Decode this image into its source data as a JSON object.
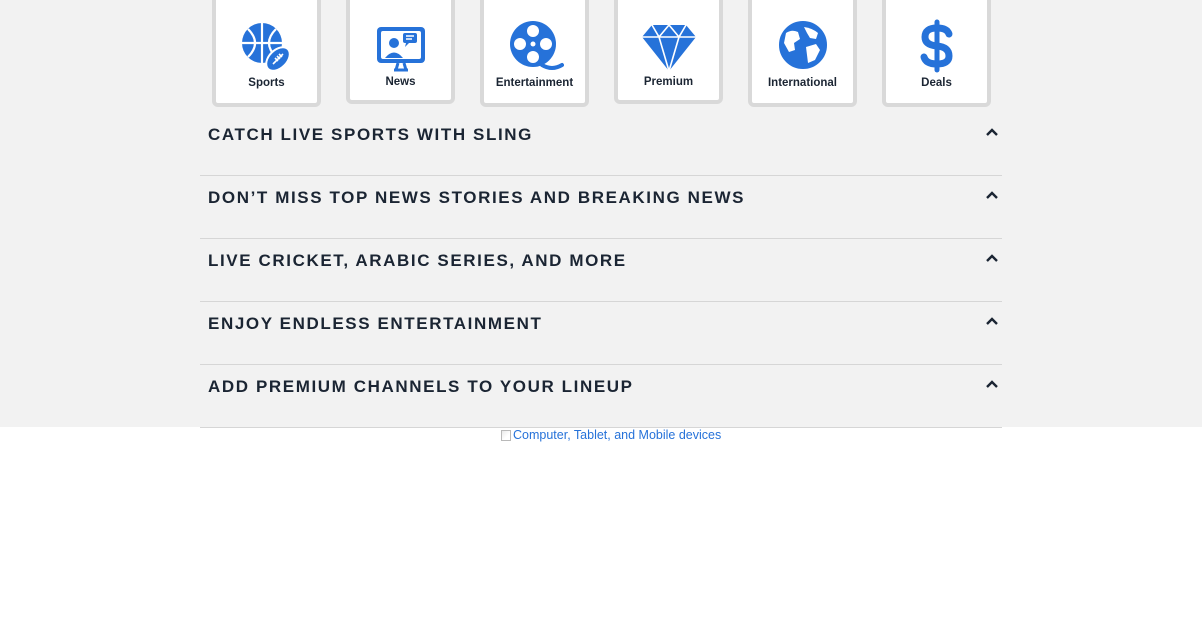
{
  "categories": [
    {
      "label": "Sports",
      "icon": "sports-icon"
    },
    {
      "label": "News",
      "icon": "news-icon"
    },
    {
      "label": "Entertainment",
      "icon": "film-reel-icon"
    },
    {
      "label": "Premium",
      "icon": "diamond-icon"
    },
    {
      "label": "International",
      "icon": "globe-icon"
    },
    {
      "label": "Deals",
      "icon": "dollar-icon"
    }
  ],
  "accordion": [
    {
      "title": "Catch Live Sports with Sling"
    },
    {
      "title": "Don’t miss top news stories and breaking news"
    },
    {
      "title": "Live cricket, Arabic series, and more"
    },
    {
      "title": "Enjoy endless entertainment"
    },
    {
      "title": "Add Premium Channels to your lineup"
    }
  ],
  "devices_image": {
    "alt": "Computer, Tablet, and Mobile devices"
  },
  "colors": {
    "accent": "#2672d9",
    "heading": "#1b2533",
    "band": "#f2f2f2"
  }
}
